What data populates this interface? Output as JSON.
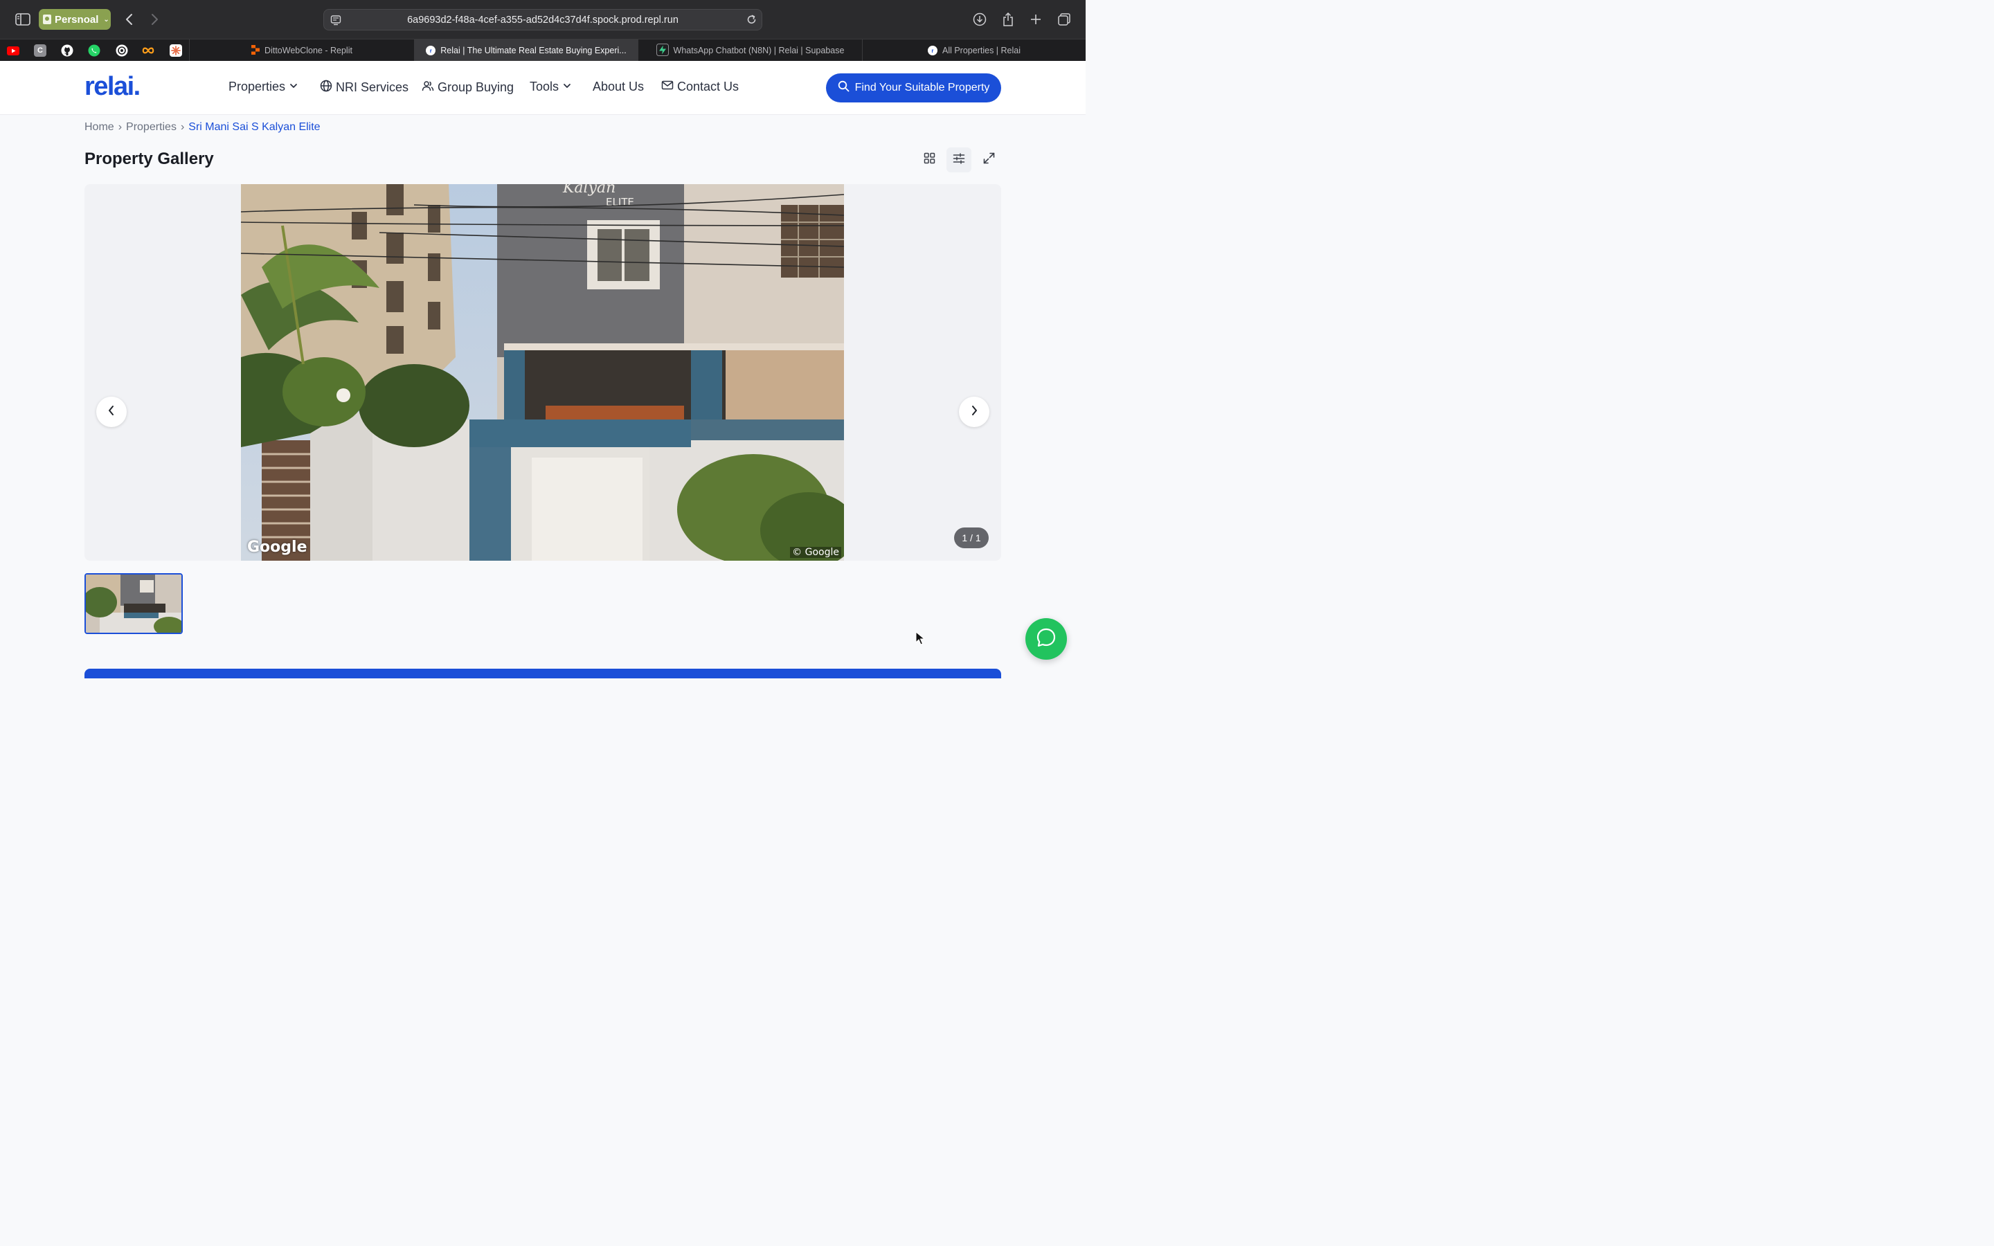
{
  "browser": {
    "profile_label": "Persnoal",
    "url": "6a9693d2-f48a-4cef-a355-ad52d4c37d4f.spock.prod.repl.run",
    "pinned_tabs": [
      {
        "icon": "youtube-icon",
        "color": "#ff0000"
      },
      {
        "icon": "c-icon",
        "color": "#8e8e93",
        "glyph": "C"
      },
      {
        "icon": "github-icon",
        "color": "#ffffff"
      },
      {
        "icon": "whatsapp-icon",
        "color": "#25d366"
      },
      {
        "icon": "chatgpt-icon",
        "color": "#ffffff"
      },
      {
        "icon": "infinity-icon",
        "color": "#ff9f1a"
      },
      {
        "icon": "claude-icon",
        "color": "#e86f4a"
      }
    ],
    "tabs": [
      {
        "title": "DittoWebClone - Replit",
        "icon": "replit-icon",
        "active": false
      },
      {
        "title": "Relai | The Ultimate Real Estate Buying Experi...",
        "icon": "relai-icon",
        "active": true
      },
      {
        "title": "WhatsApp Chatbot (N8N) | Relai | Supabase",
        "icon": "supabase-icon",
        "active": false
      },
      {
        "title": "All Properties | Relai",
        "icon": "relai-icon",
        "active": false
      }
    ]
  },
  "site": {
    "logo": "relai.",
    "brand_color": "#1b4fd8",
    "nav": {
      "properties": "Properties",
      "nri": "NRI Services",
      "group": "Group Buying",
      "tools": "Tools",
      "about": "About Us",
      "contact": "Contact Us"
    },
    "cta_label": "Find Your Suitable Property"
  },
  "breadcrumb": {
    "home": "Home",
    "properties": "Properties",
    "current": "Sri Mani Sai S Kalyan Elite",
    "separator": "›"
  },
  "gallery": {
    "title": "Property Gallery",
    "counter": "1 / 1",
    "image_watermark_left": "Google",
    "image_watermark_right": "© Google",
    "building_sign_top": "Kalyan",
    "building_sign": "ELITE"
  },
  "chat_button_color": "#22c35e"
}
